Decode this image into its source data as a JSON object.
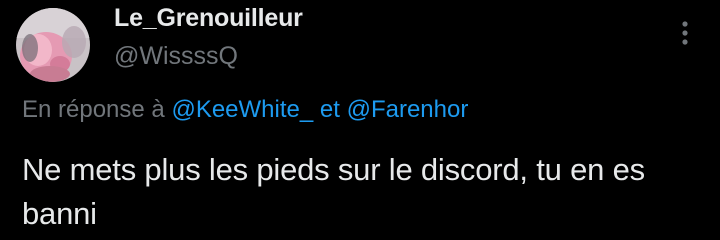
{
  "author": {
    "display_name": "Le_Grenouilleur",
    "handle": "@WissssQ",
    "avatar_icon": "pink-character-avatar"
  },
  "more_menu": {
    "icon": "more-vertical-icon"
  },
  "reply_context": {
    "prefix": "En réponse à",
    "mention_1": "@KeeWhite_",
    "conjunction": "et",
    "mention_2": "@Farenhor"
  },
  "tweet": {
    "text": "Ne mets plus les pieds sur le discord, tu en es banni"
  },
  "colors": {
    "background": "#000000",
    "primary_text": "#e7e9ea",
    "secondary_text": "#71767b",
    "link": "#1d9bf0"
  }
}
